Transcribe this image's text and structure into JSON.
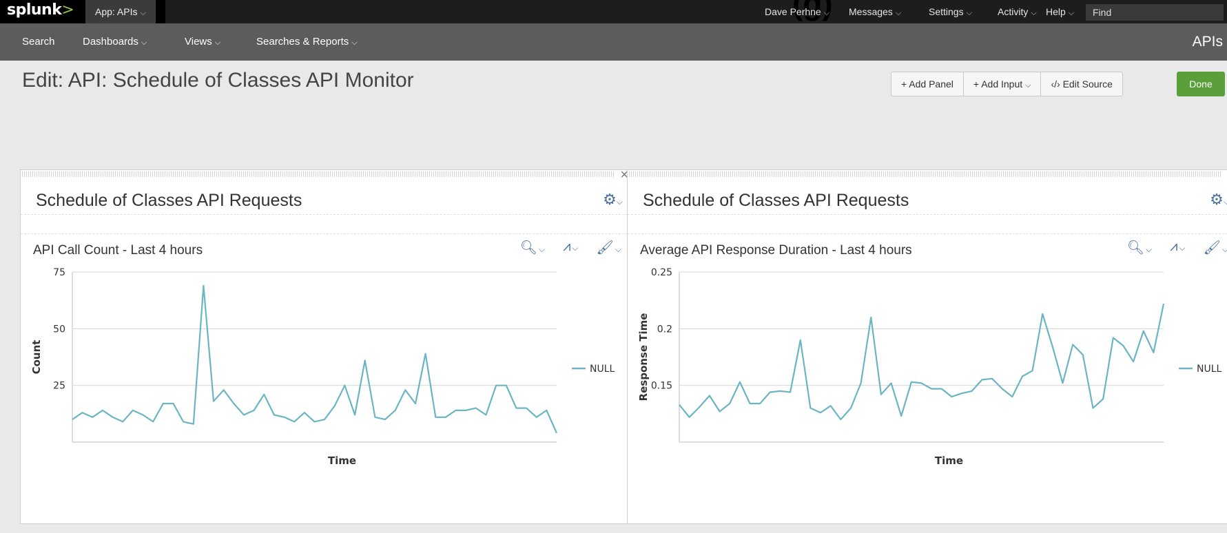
{
  "topbar": {
    "logo_text": "splunk",
    "logo_mark": ">",
    "app_label": "App: APIs",
    "nav": [
      "Dave Perhne",
      "Messages",
      "Settings",
      "Activity",
      "Help"
    ],
    "find_placeholder": "Find",
    "fragment_text": "(g)"
  },
  "appbar": {
    "items": [
      "Search",
      "Dashboards",
      "Views",
      "Searches & Reports"
    ],
    "app_title": "APIs"
  },
  "page": {
    "title": "Edit: API: Schedule of Classes API Monitor",
    "buttons": {
      "add_panel": "+ Add Panel",
      "add_input": "+ Add Input",
      "edit_source": "‹/› Edit Source",
      "done": "Done"
    }
  },
  "panels": [
    {
      "title": "Schedule of Classes API Requests",
      "subtitle": "API Call Count - Last 4 hours",
      "chart_data": {
        "type": "line",
        "xlabel": "Time",
        "ylabel": "Count",
        "ylim": [
          0,
          75
        ],
        "yticks": [
          "25",
          "50",
          "75"
        ],
        "ytick_values": [
          25,
          50,
          75
        ],
        "grid": true,
        "legend": "right",
        "series": [
          {
            "name": "NULL",
            "values": [
              10,
              13,
              11,
              14,
              11,
              9,
              14,
              12,
              9,
              17,
              17,
              9,
              8,
              69,
              18,
              23,
              17,
              12,
              14,
              21,
              12,
              11,
              9,
              13,
              9,
              10,
              16,
              25,
              12,
              36,
              11,
              10,
              14,
              23,
              17,
              39,
              11,
              11,
              14,
              14,
              15,
              12,
              25,
              25,
              15,
              15,
              11,
              14,
              4
            ]
          }
        ],
        "color": "#6ab4c4"
      }
    },
    {
      "title": "Schedule of Classes API Requests",
      "subtitle": "Average API Response Duration - Last 4 hours",
      "chart_data": {
        "type": "line",
        "xlabel": "Time",
        "ylabel": "Response Time",
        "ylim": [
          0.1,
          0.25
        ],
        "yticks": [
          "0.15",
          "0.2",
          "0.25"
        ],
        "ytick_values": [
          0.15,
          0.2,
          0.25
        ],
        "grid": true,
        "legend": "right",
        "series": [
          {
            "name": "NULL",
            "values": [
              0.133,
              0.122,
              0.131,
              0.141,
              0.127,
              0.134,
              0.153,
              0.134,
              0.134,
              0.144,
              0.145,
              0.144,
              0.19,
              0.13,
              0.126,
              0.132,
              0.12,
              0.13,
              0.152,
              0.21,
              0.142,
              0.152,
              0.123,
              0.153,
              0.152,
              0.147,
              0.147,
              0.14,
              0.143,
              0.145,
              0.155,
              0.156,
              0.147,
              0.14,
              0.158,
              0.163,
              0.213,
              0.184,
              0.152,
              0.186,
              0.177,
              0.13,
              0.138,
              0.192,
              0.185,
              0.171,
              0.198,
              0.179,
              0.222
            ]
          }
        ],
        "color": "#6ab4c4"
      }
    }
  ]
}
